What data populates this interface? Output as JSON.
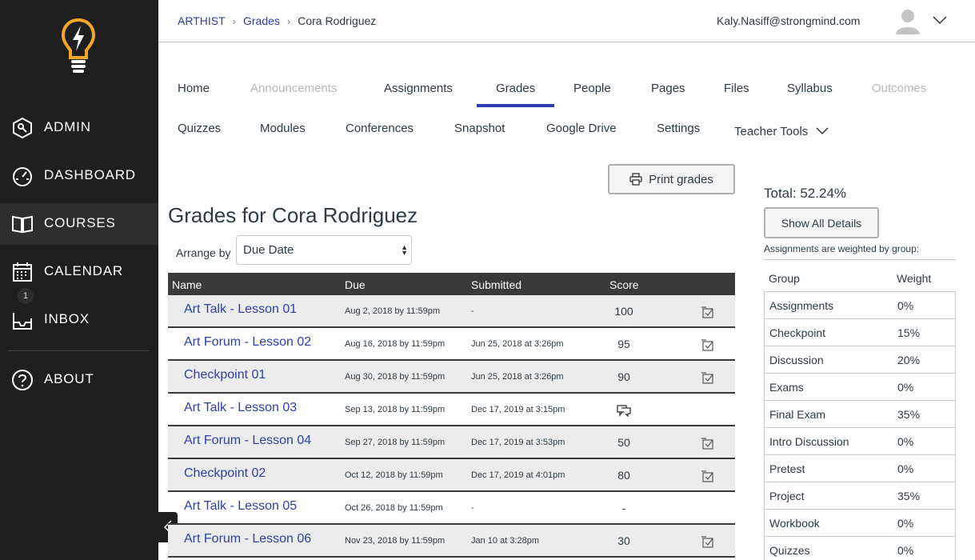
{
  "sidebar": {
    "items": [
      {
        "label": "ADMIN",
        "icon": "admin-shield-icon"
      },
      {
        "label": "DASHBOARD",
        "icon": "dashboard-gauge-icon"
      },
      {
        "label": "COURSES",
        "icon": "book-icon"
      },
      {
        "label": "CALENDAR",
        "icon": "calendar-icon"
      },
      {
        "label": "INBOX",
        "icon": "inbox-icon",
        "badge": "1"
      },
      {
        "label": "ABOUT",
        "icon": "help-circle-icon"
      }
    ],
    "active": "COURSES"
  },
  "header": {
    "breadcrumbs": [
      "ARTHIST",
      "Grades",
      "Cora Rodriguez"
    ],
    "user_email": "Kaly.Nasiff@strongmind.com"
  },
  "course_nav": {
    "row1": [
      "Home",
      "Announcements",
      "Assignments",
      "Grades",
      "People",
      "Pages",
      "Files",
      "Syllabus",
      "Outcomes"
    ],
    "row2": [
      "Quizzes",
      "Modules",
      "Conferences",
      "Snapshot",
      "Google Drive",
      "Settings",
      "Teacher Tools"
    ],
    "active": "Grades",
    "disabled": [
      "Announcements",
      "Outcomes"
    ]
  },
  "print_label": "Print grades",
  "page_title": "Grades for Cora Rodriguez",
  "arrange": {
    "label": "Arrange by",
    "value": "Due Date"
  },
  "grades_table": {
    "headers": [
      "Name",
      "Due",
      "Submitted",
      "Score"
    ],
    "rows": [
      {
        "name": "Art Talk - Lesson 01",
        "due": "Aug 2, 2018 by 11:59pm",
        "submitted": "-",
        "score": "100"
      },
      {
        "name": "Art Forum - Lesson 02",
        "due": "Aug 16, 2018 by 11:59pm",
        "submitted": "Jun 25, 2018 at 3:26pm",
        "score": "95"
      },
      {
        "name": "Checkpoint 01",
        "due": "Aug 30, 2018 by 11:59pm",
        "submitted": "Jun 25, 2018 at 3:26pm",
        "score": "90"
      },
      {
        "name": "Art Talk - Lesson 03",
        "due": "Sep 13, 2018 by 11:59pm",
        "submitted": "Dec 17, 2019 at 3:15pm",
        "score": ""
      },
      {
        "name": "Art Forum - Lesson 04",
        "due": "Sep 27, 2018 by 11:59pm",
        "submitted": "Dec 17, 2019 at 3:53pm",
        "score": "50"
      },
      {
        "name": "Checkpoint 02",
        "due": "Oct 12, 2018 by 11:59pm",
        "submitted": "Dec 17, 2019 at 4:01pm",
        "score": "80"
      },
      {
        "name": "Art Talk - Lesson 05",
        "due": "Oct 26, 2018 by 11:59pm",
        "submitted": "-",
        "score": "-"
      },
      {
        "name": "Art Forum - Lesson 06",
        "due": "Nov 23, 2018 by 11:59pm",
        "submitted": "Jan 10 at 3:28pm",
        "score": "30"
      }
    ]
  },
  "total": "Total: 52.24%",
  "show_details_label": "Show All Details",
  "weighted_note": "Assignments are weighted by group:",
  "weights_table": {
    "headers": [
      "Group",
      "Weight"
    ],
    "rows": [
      {
        "group": "Assignments",
        "weight": "0%"
      },
      {
        "group": "Checkpoint",
        "weight": "15%"
      },
      {
        "group": "Discussion",
        "weight": "20%"
      },
      {
        "group": "Exams",
        "weight": "0%"
      },
      {
        "group": "Final Exam",
        "weight": "35%"
      },
      {
        "group": "Intro Discussion",
        "weight": "0%"
      },
      {
        "group": "Pretest",
        "weight": "0%"
      },
      {
        "group": "Project",
        "weight": "35%"
      },
      {
        "group": "Workbook",
        "weight": "0%"
      },
      {
        "group": "Quizzes",
        "weight": "0%"
      }
    ]
  },
  "colors": {
    "sidebar_bg": "#1f1f1f",
    "link": "#2b3fad",
    "logo": "#f5a623",
    "table_header": "#3a3a3a"
  }
}
